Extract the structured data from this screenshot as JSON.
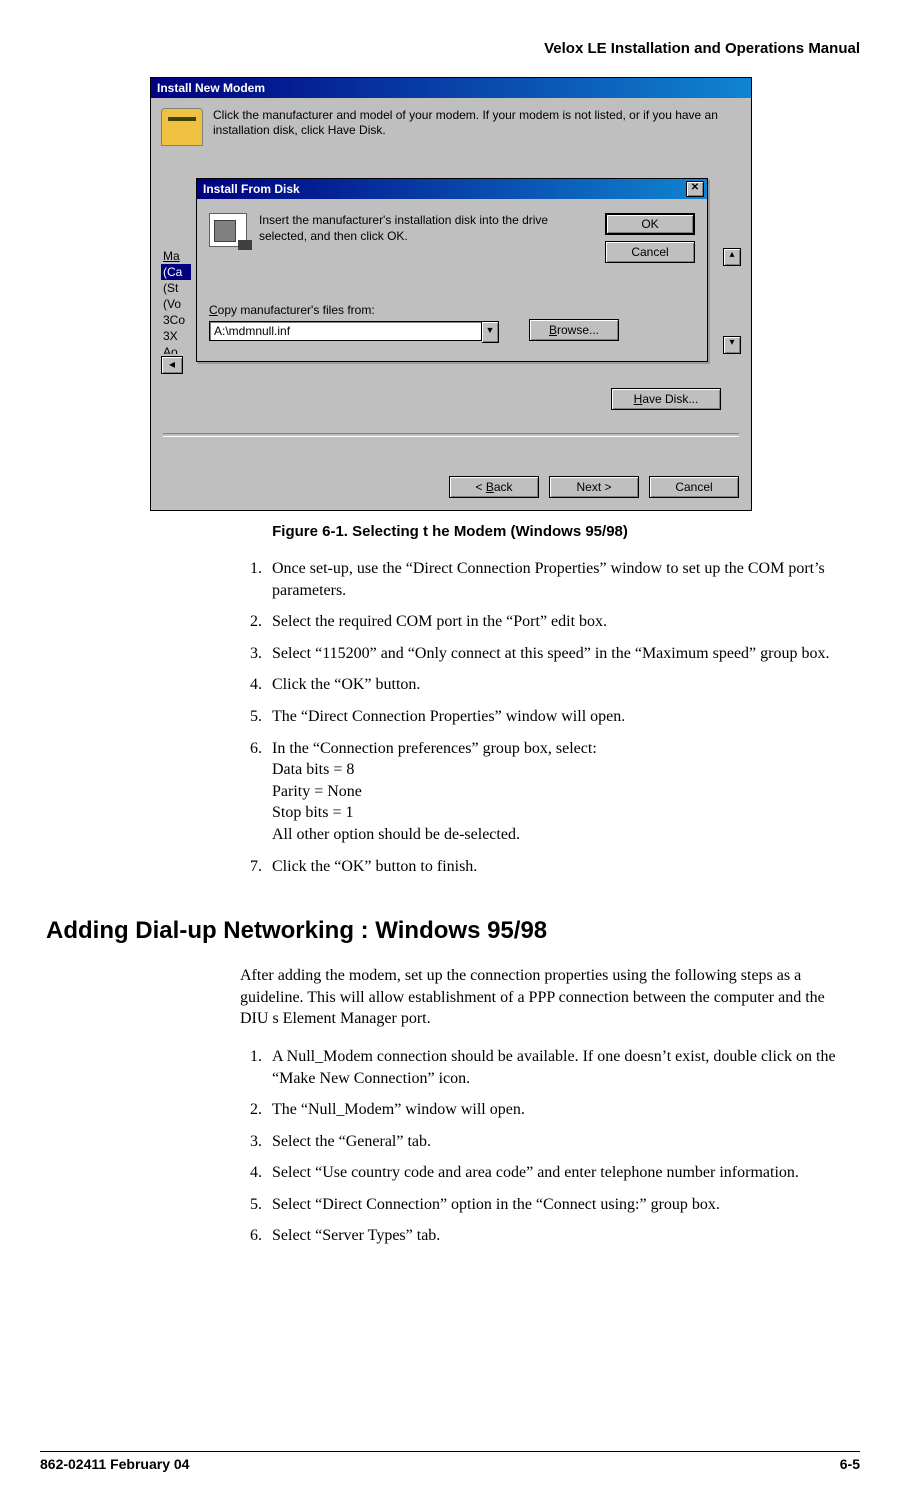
{
  "doc_header": "Velox LE Installation and Operations Manual",
  "screenshot": {
    "outer_title": "Install New Modem",
    "outer_instr": "Click the manufacturer and model of your modem. If your modem is not listed, or if you have an installation disk, click Have Disk.",
    "mfr_label": "Ma",
    "list_items": [
      "(Ca",
      "(St",
      "(Vo",
      "3Co",
      "3X",
      "Ao"
    ],
    "have_disk": "Have Disk...",
    "back": "< Back",
    "next": "Next >",
    "cancel": "Cancel",
    "inner": {
      "title": "Install From Disk",
      "instr": "Insert the manufacturer's installation disk into the drive selected, and then click OK.",
      "ok": "OK",
      "cancel": "Cancel",
      "copy_label": "Copy manufacturer's files from:",
      "path": "A:\\mdmnull.inf",
      "browse": "Browse..."
    }
  },
  "figure_caption": "Figure 6-1.  Selecting t he Modem (Windows 95/98)",
  "list1": {
    "i1": "Once set-up, use the “Direct Connection Properties” window to set up the COM port’s parameters.",
    "i2": "Select the required COM port in the “Port” edit box.",
    "i3": "Select “115200” and “Only connect at this speed” in the “Maximum speed” group box.",
    "i4": "Click the “OK” button.",
    "i5": "The “Direct Connection Properties” window will open.",
    "i6": "In the “Connection preferences” group box, select:",
    "i6a": "Data bits = 8",
    "i6b": "Parity = None",
    "i6c": "Stop bits = 1",
    "i6d": "All other option should be de-selected.",
    "i7": "Click the “OK” button to finish."
  },
  "section_heading": "Adding Dial-up Networking : Windows 95/98",
  "intro_para": "After adding the modem, set up the connection properties using the following steps as a guideline.  This will allow establishment of a PPP connection between the computer and the DIU s Element Manager port.",
  "list2": {
    "i1": "A Null_Modem connection should be available.  If one doesn’t exist, double click on the “Make New Connection” icon.",
    "i2": "The “Null_Modem” window will open.",
    "i3": "Select the “General” tab.",
    "i4": "Select “Use country code and area code” and enter telephone number information.",
    "i5": "Select “Direct Connection” option in the “Connect using:” group box.",
    "i6": "Select “Server Types” tab."
  },
  "footer_left": "862-02411 February 04",
  "footer_right": "6-5"
}
